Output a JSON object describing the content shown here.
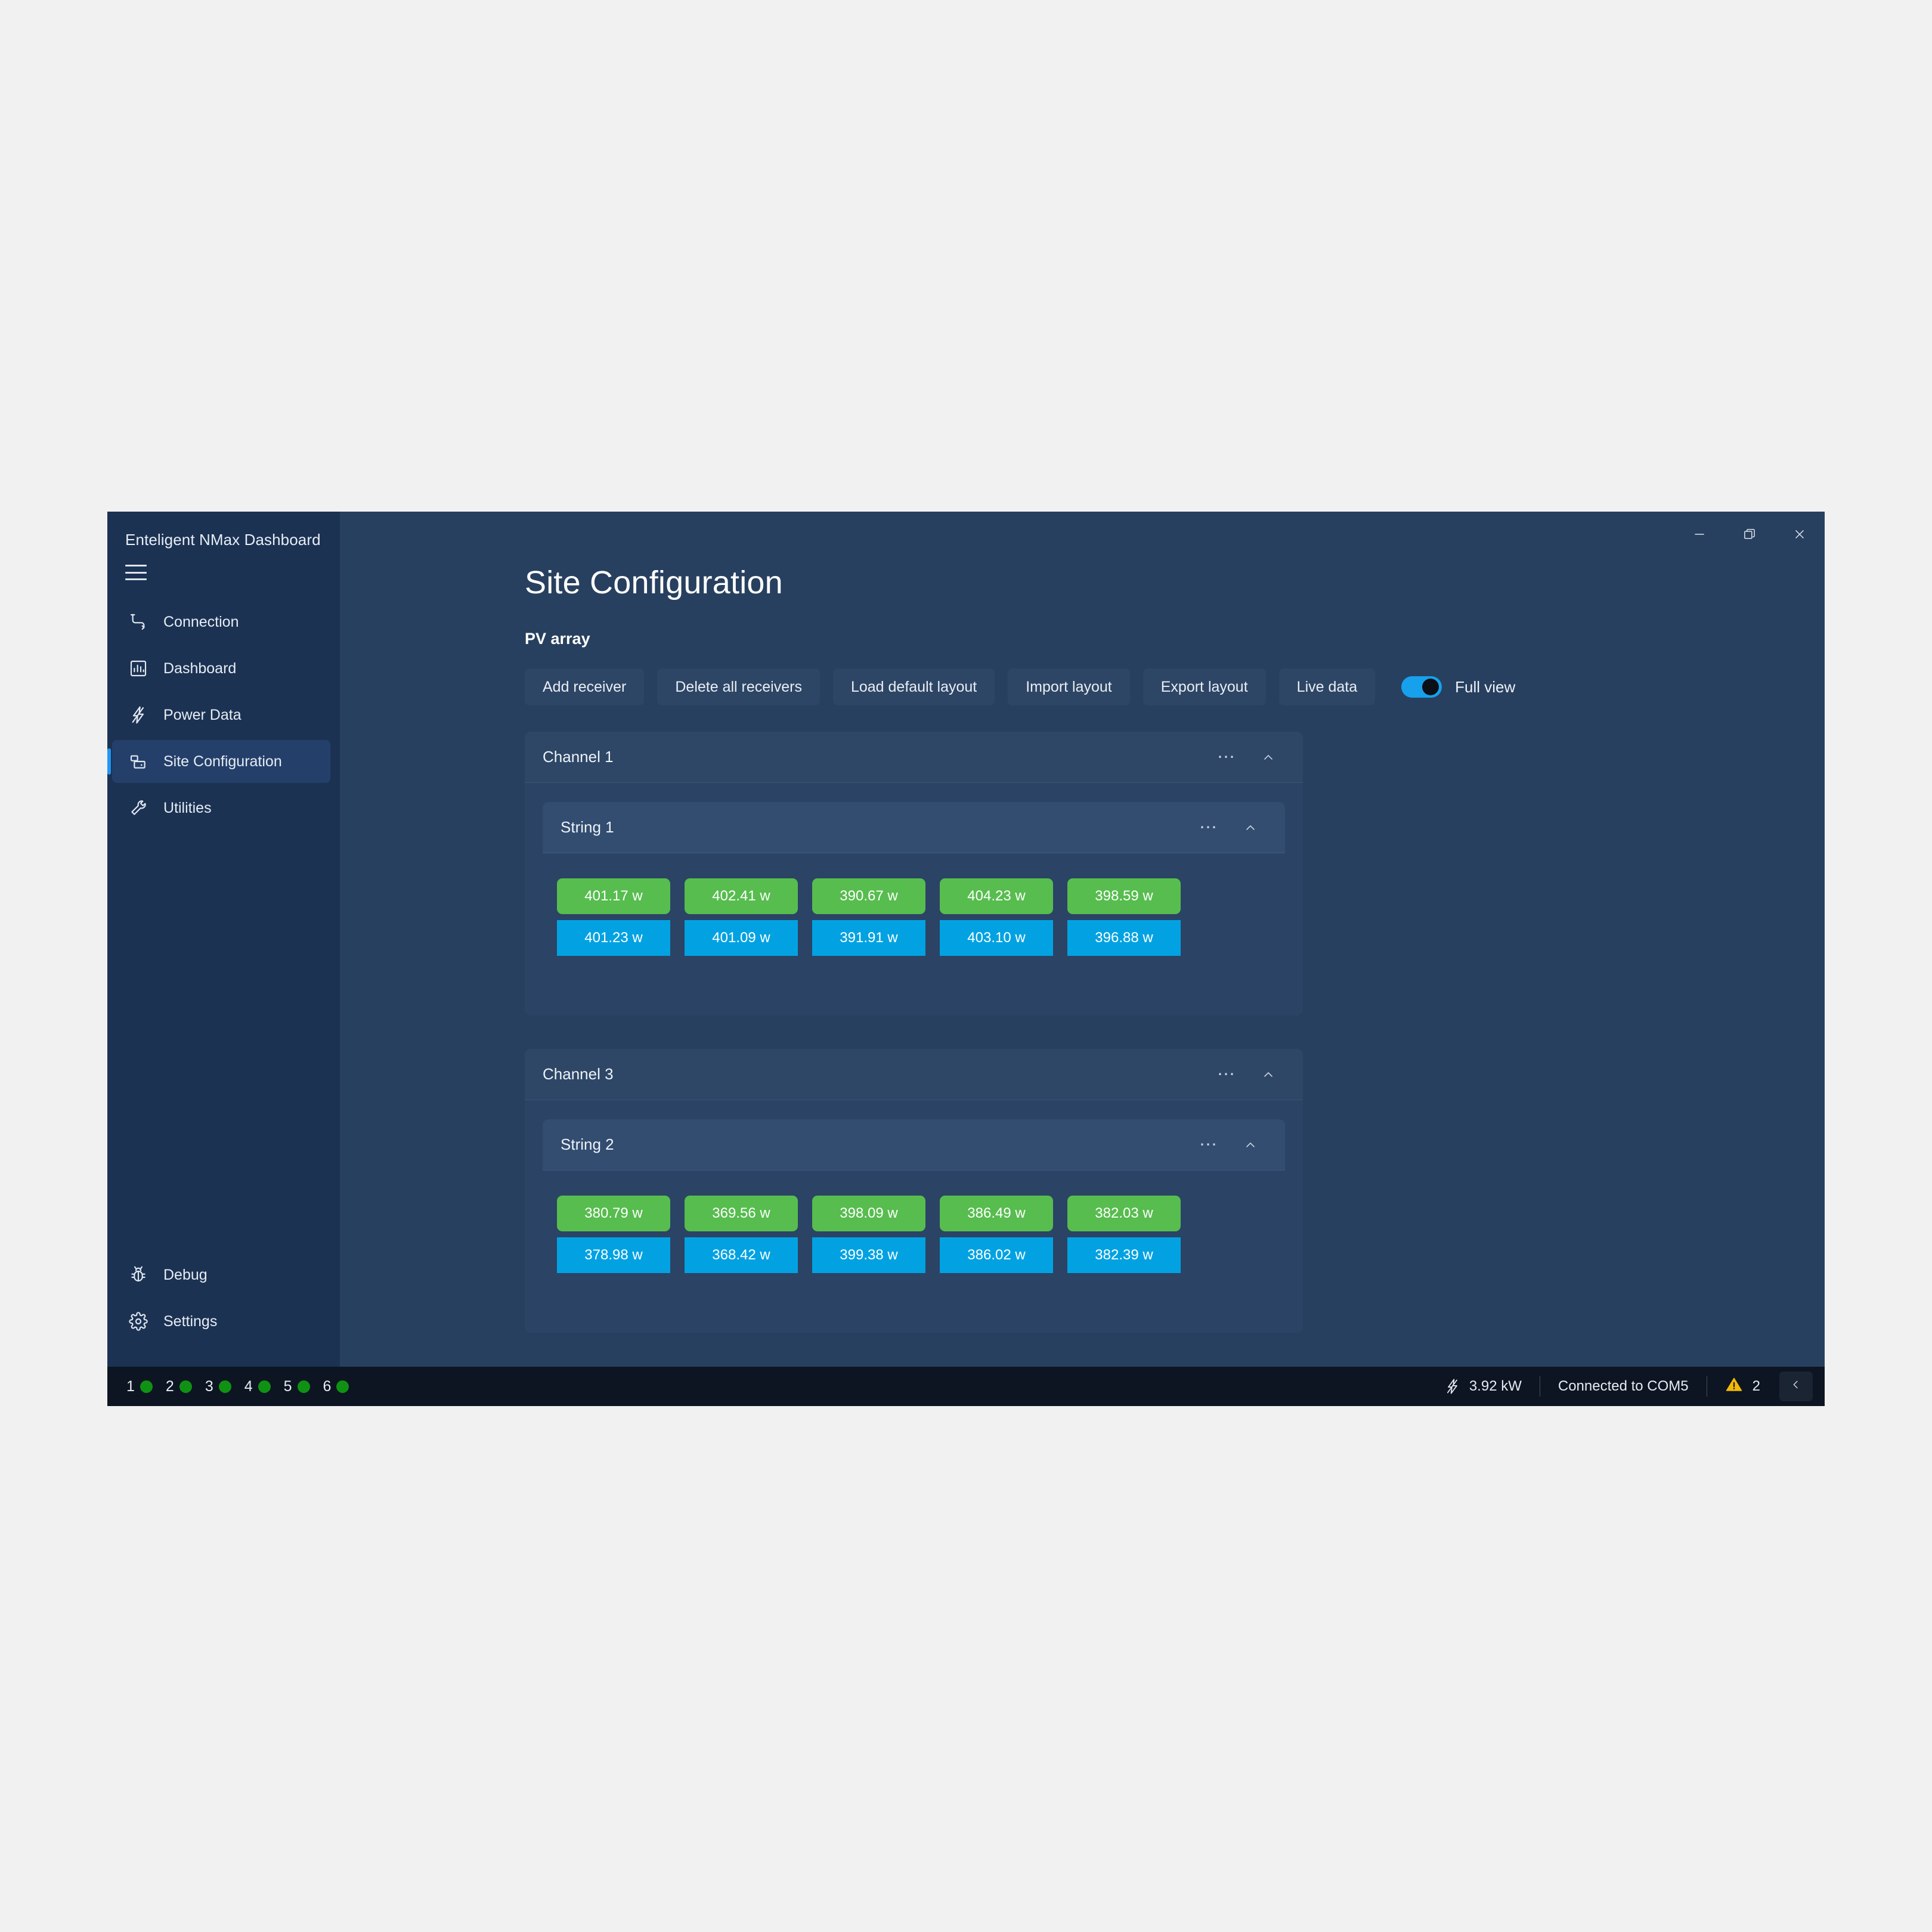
{
  "window": {
    "title": "Enteligent NMax Dashboard",
    "controls": {
      "minimize": "minimize-icon",
      "restore": "restore-icon",
      "close": "close-icon"
    }
  },
  "sidebar": {
    "menu_icon": "hamburger-icon",
    "items": [
      {
        "label": "Connection",
        "icon": "plug-connection-icon",
        "active": false
      },
      {
        "label": "Dashboard",
        "icon": "bar-chart-icon",
        "active": false
      },
      {
        "label": "Power Data",
        "icon": "lightning-bolt-icon",
        "active": false
      },
      {
        "label": "Site Configuration",
        "icon": "site-layout-icon",
        "active": true
      },
      {
        "label": "Utilities",
        "icon": "wrench-icon",
        "active": false
      }
    ],
    "bottom_items": [
      {
        "label": "Debug",
        "icon": "bug-icon"
      },
      {
        "label": "Settings",
        "icon": "gear-icon"
      }
    ]
  },
  "main": {
    "page_title": "Site Configuration",
    "section_title": "PV array",
    "toolbar": {
      "buttons": [
        "Add receiver",
        "Delete all receivers",
        "Load default layout",
        "Import layout",
        "Export layout",
        "Live data"
      ],
      "toggle": {
        "label": "Full view",
        "on": true
      }
    },
    "channels": [
      {
        "title": "Channel 1",
        "more_icon": "ellipsis-icon",
        "collapse_icon": "chevron-up-icon",
        "strings": [
          {
            "title": "String 1",
            "more_icon": "ellipsis-icon",
            "collapse_icon": "chevron-up-icon",
            "rows": [
              {
                "color": "green",
                "values": [
                  "401.17 w",
                  "402.41 w",
                  "390.67 w",
                  "404.23 w",
                  "398.59 w"
                ]
              },
              {
                "color": "blue",
                "values": [
                  "401.23 w",
                  "401.09 w",
                  "391.91 w",
                  "403.10 w",
                  "396.88 w"
                ]
              }
            ]
          }
        ]
      },
      {
        "title": "Channel 3",
        "more_icon": "ellipsis-icon",
        "collapse_icon": "chevron-up-icon",
        "strings": [
          {
            "title": "String 2",
            "more_icon": "ellipsis-icon",
            "collapse_icon": "chevron-up-icon",
            "rows": [
              {
                "color": "green",
                "values": [
                  "380.79 w",
                  "369.56 w",
                  "398.09 w",
                  "386.49 w",
                  "382.03 w"
                ]
              },
              {
                "color": "blue",
                "values": [
                  "378.98 w",
                  "368.42 w",
                  "399.38 w",
                  "386.02 w",
                  "382.39 w"
                ]
              }
            ]
          }
        ]
      }
    ]
  },
  "statusbar": {
    "leds": [
      {
        "number": "1",
        "state": "green"
      },
      {
        "number": "2",
        "state": "green"
      },
      {
        "number": "3",
        "state": "green"
      },
      {
        "number": "4",
        "state": "green"
      },
      {
        "number": "5",
        "state": "green"
      },
      {
        "number": "6",
        "state": "green"
      }
    ],
    "power": "3.92 kW",
    "power_icon": "lightning-bolt-icon",
    "connection": "Connected to COM5",
    "warning_icon": "warning-triangle-icon",
    "warning_count": "2",
    "collapse_icon": "chevron-left-icon"
  },
  "colors": {
    "accent_blue": "#2196f3",
    "tile_green": "#57bd4e",
    "tile_blue": "#02a2e2",
    "led_green": "#0f9213",
    "warning_yellow": "#f2b807",
    "window_bg": "#1d3557",
    "content_bg": "#28405f",
    "statusbar_bg": "#0d1522",
    "toggle_on": "#17a0eb"
  }
}
